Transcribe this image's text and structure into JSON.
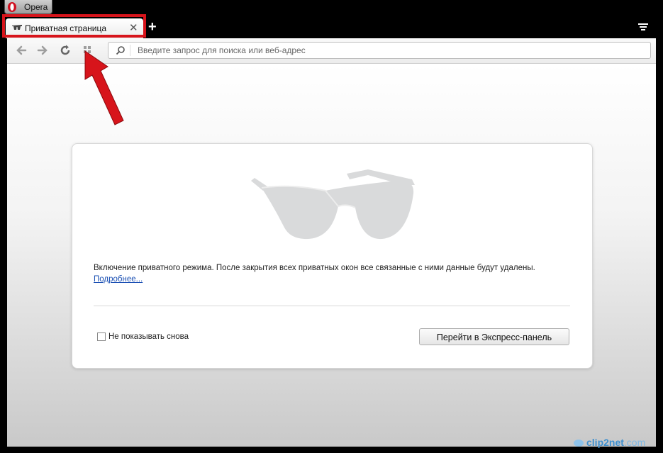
{
  "app": {
    "menu_label": "Opera"
  },
  "tabs": [
    {
      "title": "Приватная страница",
      "icon": "private-glasses-icon",
      "close": "✕"
    }
  ],
  "toolbar": {
    "address_placeholder": "Введите запрос для поиска или веб-адрес"
  },
  "private_page": {
    "info_text": "Включение приватного режима. После закрытия всех приватных окон все связанные с ними данные будут удалены.",
    "more_link": "Подробнее...",
    "dont_show_label": "Не показывать снова",
    "dont_show_checked": false,
    "speed_dial_button": "Перейти в Экспресс-панель"
  },
  "watermark": {
    "text_main": "clip2net",
    "text_suffix": ".com"
  },
  "colors": {
    "annotation_red": "#d7141b",
    "link_blue": "#1a4fb3"
  }
}
